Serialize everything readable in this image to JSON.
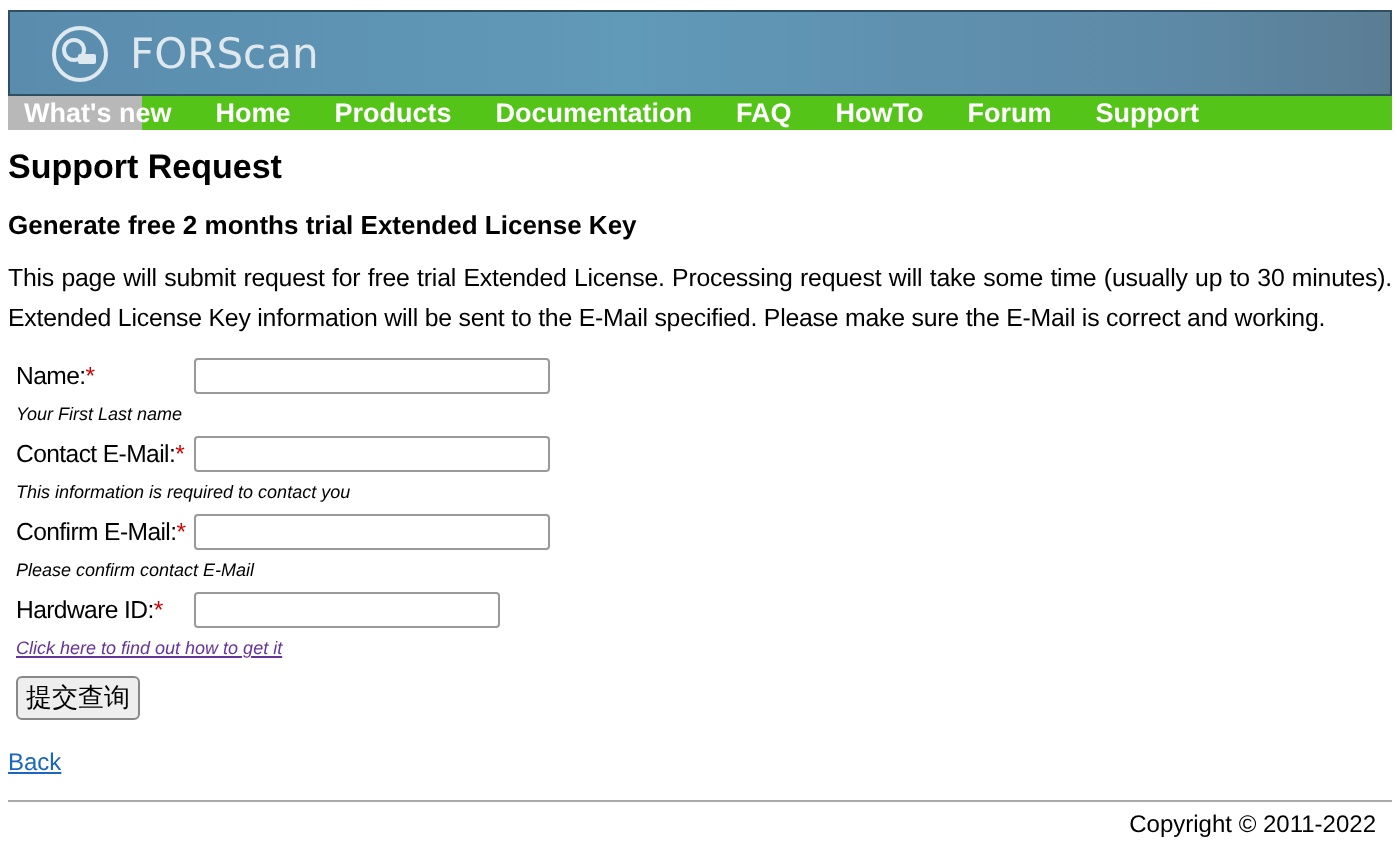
{
  "header": {
    "title": "FORScan"
  },
  "nav": [
    {
      "label": "What's new",
      "selected": true
    },
    {
      "label": "Home",
      "selected": false
    },
    {
      "label": "Products",
      "selected": false
    },
    {
      "label": "Documentation",
      "selected": false
    },
    {
      "label": "FAQ",
      "selected": false
    },
    {
      "label": "HowTo",
      "selected": false
    },
    {
      "label": "Forum",
      "selected": false
    },
    {
      "label": "Support",
      "selected": false
    }
  ],
  "page_title": "Support Request",
  "subtitle": "Generate free 2 months trial Extended License Key",
  "intro": "This page will submit request for free trial Extended License. Processing request will take some time (usually up to 30 minutes). Extended License Key information will be sent to the E-Mail specified. Please make sure the E-Mail is correct and working.",
  "form": [
    {
      "label": "Name:",
      "required_mark": "*",
      "hint": "Your First Last name",
      "hint_link": false,
      "wide": true
    },
    {
      "label": "Contact E-Mail:",
      "required_mark": "*",
      "hint": "This information is required to contact you",
      "hint_link": false,
      "wide": true
    },
    {
      "label": "Confirm E-Mail:",
      "required_mark": "*",
      "hint": "Please confirm contact E-Mail",
      "hint_link": false,
      "wide": true
    },
    {
      "label": "Hardware ID:",
      "required_mark": "*",
      "hint": "Click here to find out how to get it",
      "hint_link": true,
      "wide": false
    }
  ],
  "submit": "提交查询",
  "back_link": "Back",
  "footer": "Copyright © 2011-2022"
}
